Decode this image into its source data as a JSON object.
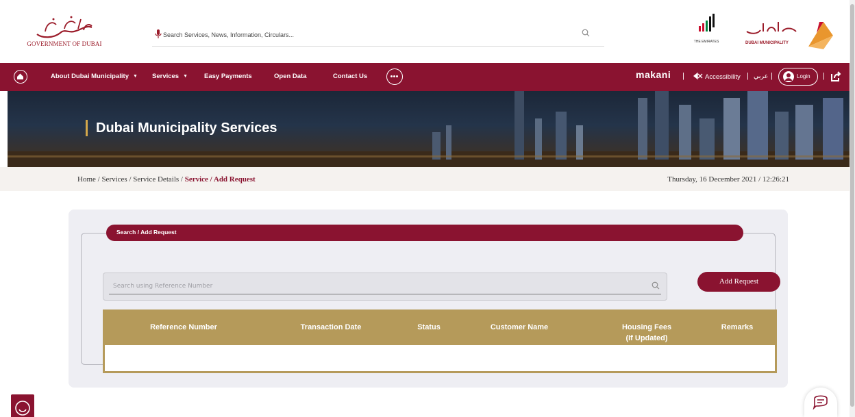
{
  "header": {
    "gov_logo_text": "GOVERNMENT OF DUBAI",
    "search_placeholder": "Search Services, News, Information, Circulars...",
    "uae_caption": "THE EMIRATES",
    "dm_caption": "DUBAI MUNICIPALITY"
  },
  "nav": {
    "items": [
      {
        "label": "About Dubai Municipality",
        "has_dropdown": true
      },
      {
        "label": "Services",
        "has_dropdown": true
      },
      {
        "label": "Easy Payments",
        "has_dropdown": false
      },
      {
        "label": "Open Data",
        "has_dropdown": false
      },
      {
        "label": "Contact Us",
        "has_dropdown": false
      }
    ],
    "makani": "makani",
    "accessibility": "Accessibility",
    "language": "عربي",
    "login": "Login",
    "separator": "|"
  },
  "banner": {
    "title": "Dubai Municipality Services"
  },
  "breadcrumb": {
    "path": "Home / Services / Service Details / ",
    "current": "Service / Add Request",
    "datetime": "Thursday, 16 December 2021  / 12:26:21"
  },
  "panel": {
    "legend": "Search / Add Request",
    "search_placeholder": "Search using Reference Number",
    "add_button": "Add Request",
    "columns": [
      "Reference Number",
      "Transaction Date",
      "Status",
      "Customer Name",
      "Housing Fees\n(If Updated)",
      "Remarks"
    ]
  },
  "colors": {
    "brand": "#8a1330",
    "gold": "#b59a5a",
    "panel_bg": "#eeeef3"
  }
}
